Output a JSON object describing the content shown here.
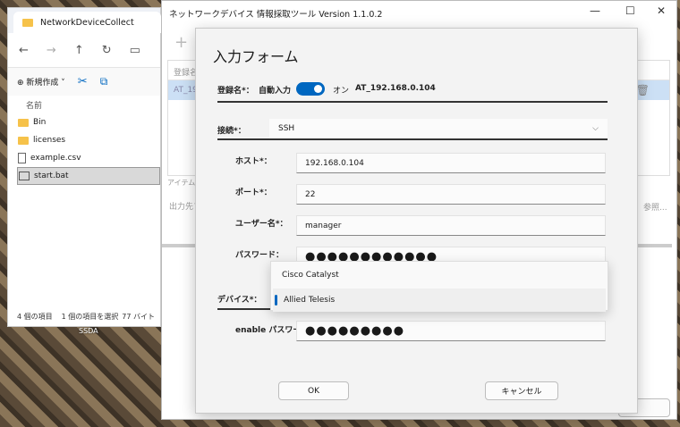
{
  "explorer": {
    "tab_title": "NetworkDeviceCollect",
    "new_label": "新規作成",
    "column_name": "名前",
    "items": [
      {
        "name": "Bin",
        "type": "folder"
      },
      {
        "name": "licenses",
        "type": "folder"
      },
      {
        "name": "example.csv",
        "type": "file"
      },
      {
        "name": "start.bat",
        "type": "bat",
        "selected": true
      }
    ],
    "status_count": "4 個の項目",
    "status_selected": "1 個の項目を選択",
    "status_size": "77 バイト"
  },
  "desktop_label": "SSDA",
  "app": {
    "title": "ネットワークデバイス 情報採取ツール Version 1.1.0.2",
    "list_header": "登録名",
    "list_row": "AT_192",
    "item_count_label": "アイテム数",
    "output_label": "出力先フ",
    "browse_label": "参照..."
  },
  "dialog": {
    "title": "入力フォーム",
    "reg_label": "登録名*：",
    "auto_label": "自動入力",
    "toggle_state": "オン",
    "toggle_on": true,
    "reg_value": "AT_192.168.0.104",
    "conn_label": "接続*：",
    "conn_value": "SSH",
    "host_label": "ホスト*：",
    "host_value": "192.168.0.104",
    "port_label": "ポート*：",
    "port_value": "22",
    "user_label": "ユーザー名*：",
    "user_value": "manager",
    "pass_label": "パスワード：",
    "pass_value": "●●●●●●●●●●●●",
    "device_label": "デバイス*：",
    "device_options": [
      "Cisco Catalyst",
      "Allied Telesis"
    ],
    "device_selected": "Allied Telesis",
    "enable_label": "enable パスワード：",
    "enable_value": "●●●●●●●●●",
    "ok": "OK",
    "cancel": "キャンセル"
  },
  "colors": {
    "accent": "#0067c0"
  }
}
